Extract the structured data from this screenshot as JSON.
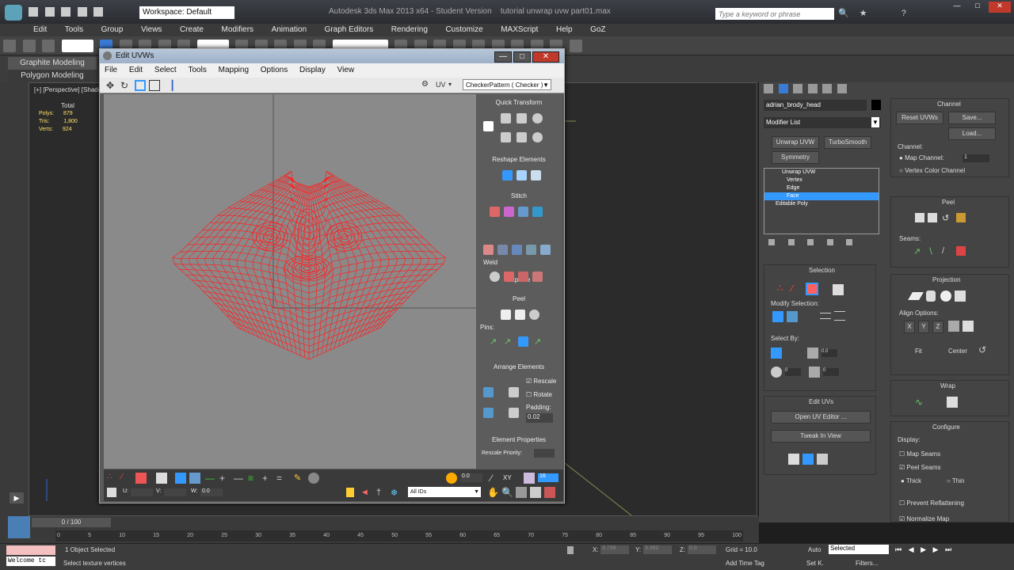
{
  "app": {
    "title": "Autodesk 3ds Max 2013 x64 - Student Version",
    "file": "tutorial unwrap uvw part01.max",
    "workspace": "Workspace: Default",
    "search_placeholder": "Type a keyword or phrase"
  },
  "menu": [
    "Edit",
    "Tools",
    "Group",
    "Views",
    "Create",
    "Modifiers",
    "Animation",
    "Graph Editors",
    "Rendering",
    "Customize",
    "MAXScript",
    "Help",
    "GoZ"
  ],
  "ribbon": {
    "tab1": "Graphite Modeling",
    "tab2": "Polygon Modeling"
  },
  "viewport": {
    "label": "[+] [Perspective] [Shaded]",
    "stats_header": "Total",
    "stats": [
      {
        "k": "Polys:",
        "v": "879"
      },
      {
        "k": "Tris:",
        "v": "1,800"
      },
      {
        "k": "Verts:",
        "v": "924"
      }
    ]
  },
  "uvw": {
    "title": "Edit UVWs",
    "menu": [
      "File",
      "Edit",
      "Select",
      "Tools",
      "Mapping",
      "Options",
      "Display",
      "View"
    ],
    "uv_label": "UV",
    "pattern": "CheckerPattern  ( Checker )",
    "rollouts": {
      "quick_transform": "Quick Transform",
      "reshape": "Reshape Elements",
      "stitch": "Stitch",
      "explode": "Explode",
      "weld": "Weld",
      "peel": "Peel",
      "pins": "Pins:",
      "arrange": "Arrange Elements",
      "rescale": "Rescale",
      "rotate": "Rotate",
      "padding_label": "Padding:",
      "padding": "0.02",
      "elem_props": "Element Properties",
      "rescale_priority": "Rescale Priority:"
    },
    "bottom": {
      "u": "U:",
      "v": "V:",
      "w": "W:",
      "w_val": "0.0",
      "spinner": "0.0",
      "xy": "XY",
      "num": "16",
      "ids": "All IDs"
    }
  },
  "cmd": {
    "object_name": "adrian_brody_head",
    "modifier_list": "Modifier List",
    "btn_unwrap": "Unwrap UVW",
    "btn_turbo": "TurboSmooth",
    "btn_symmetry": "Symmetry",
    "stack": [
      "Unwrap UVW",
      "Vertex",
      "Edge",
      "Face",
      "Editable Poly"
    ],
    "selection": "Selection",
    "modify_selection": "Modify Selection:",
    "select_by": "Select By:",
    "sel_val1": "0.0",
    "sel_val2": "0",
    "sel_val3": "0",
    "edit_uvs": "Edit UVs",
    "open_uv_editor": "Open UV Editor ...",
    "tweak": "Tweak In View",
    "channel": "Channel",
    "reset_uvws": "Reset UVWs",
    "save": "Save...",
    "load": "Load...",
    "channel_label": "Channel:",
    "map_channel": "Map Channel:",
    "map_channel_val": "1",
    "vertex_color": "Vertex Color Channel",
    "peel": "Peel",
    "seams": "Seams:",
    "projection": "Projection",
    "align_options": "Align Options:",
    "align_x": "X",
    "align_y": "Y",
    "align_z": "Z",
    "fit": "Fit",
    "center": "Center",
    "wrap": "Wrap",
    "configure": "Configure",
    "display": "Display:",
    "map_seams": "Map Seams",
    "peel_seams": "Peel Seams",
    "thick": "Thick",
    "thin": "Thin",
    "prevent_reflat": "Prevent Reflattening",
    "normalize": "Normalize Map"
  },
  "timeline": {
    "frame": "0 / 100",
    "ticks": [
      "0",
      "5",
      "10",
      "15",
      "20",
      "25",
      "30",
      "35",
      "40",
      "45",
      "50",
      "55",
      "60",
      "65",
      "70",
      "75",
      "80",
      "85",
      "90",
      "95",
      "100"
    ]
  },
  "status": {
    "welcome": "Welcome tc",
    "selected": "1 Object Selected",
    "prompt": "Select texture vertices",
    "x_label": "X:",
    "x": "3.739",
    "y_label": "Y:",
    "y": "3.382",
    "z_label": "Z:",
    "z": "0.0",
    "grid": "Grid = 10.0",
    "add_time_tag": "Add Time Tag",
    "auto": "Auto",
    "set_k": "Set K.",
    "filters": "Filters...",
    "sel_dropdown": "Selected"
  },
  "colors": {
    "mesh": "#ff2020",
    "accent": "#3399ff"
  }
}
